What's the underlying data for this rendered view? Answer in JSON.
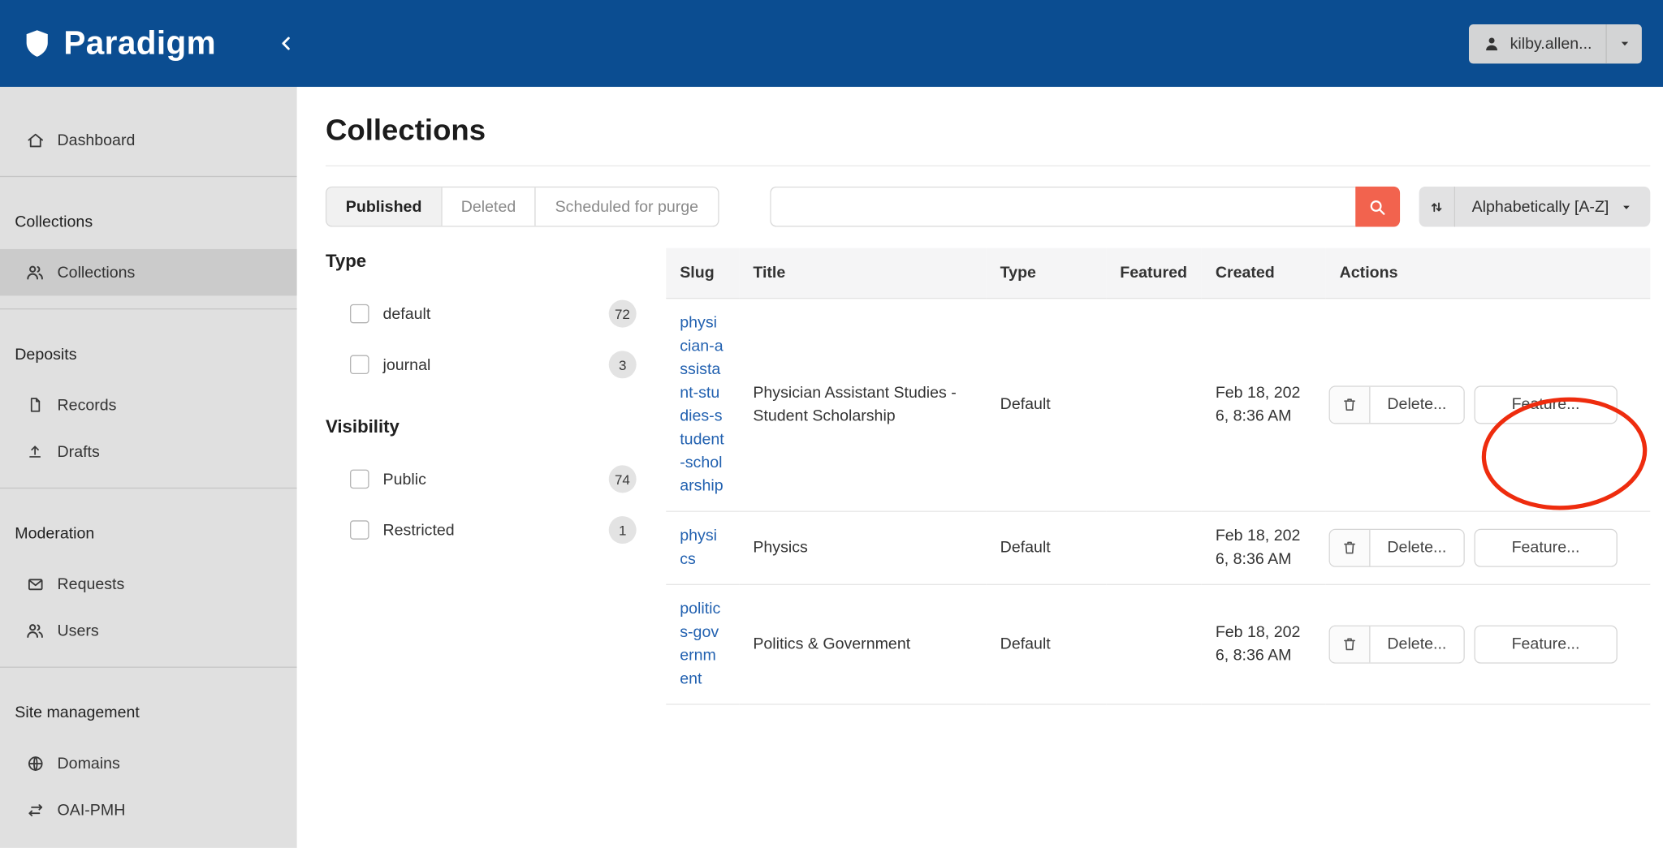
{
  "theme": {
    "navbar_color": "#0b4d91",
    "sidebar_color": "#e0e0e0",
    "search_button_color": "#f2634e",
    "link_color": "#2261b0"
  },
  "navbar": {
    "brand": "Paradigm",
    "user_label": "kilby.allen..."
  },
  "sidebar": {
    "sections": [
      {
        "header": "",
        "items": [
          {
            "label": "Dashboard"
          }
        ]
      },
      {
        "header": "Collections",
        "items": [
          {
            "label": "Collections"
          }
        ]
      },
      {
        "header": "Deposits",
        "items": [
          {
            "label": "Records"
          },
          {
            "label": "Drafts"
          }
        ]
      },
      {
        "header": "Moderation",
        "items": [
          {
            "label": "Requests"
          },
          {
            "label": "Users"
          }
        ]
      },
      {
        "header": "Site management",
        "items": [
          {
            "label": "Domains"
          },
          {
            "label": "OAI-PMH"
          }
        ]
      }
    ]
  },
  "main": {
    "title": "Collections",
    "tabs": [
      {
        "label": "Published"
      },
      {
        "label": "Deleted"
      },
      {
        "label": "Scheduled for purge"
      }
    ],
    "search": {
      "value": ""
    },
    "sort_label": "Alphabetically [A-Z]",
    "filters": [
      {
        "title": "Type",
        "options": [
          {
            "label": "default",
            "count": "72"
          },
          {
            "label": "journal",
            "count": "3"
          }
        ]
      },
      {
        "title": "Visibility",
        "options": [
          {
            "label": "Public",
            "count": "74"
          },
          {
            "label": "Restricted",
            "count": "1"
          }
        ]
      }
    ],
    "table": {
      "headers": [
        "Slug",
        "Title",
        "Type",
        "Featured",
        "Created",
        "Actions"
      ],
      "actions": {
        "delete": "Delete...",
        "feature": "Feature..."
      },
      "rows": [
        {
          "slug": "physician-assistant-studies-student-scholarship",
          "title": "Physician Assistant Studies - Student Scholarship",
          "type": "Default",
          "featured": "",
          "created": "Feb 18, 2026, 8:36 AM"
        },
        {
          "slug": "physics",
          "title": "Physics",
          "type": "Default",
          "featured": "",
          "created": "Feb 18, 2026, 8:36 AM"
        },
        {
          "slug": "politics-government",
          "title": "Politics & Government",
          "type": "Default",
          "featured": "",
          "created": "Feb 18, 2026, 8:36 AM"
        }
      ]
    }
  },
  "annotation": {
    "shape": "ellipse",
    "color": "#ee2c0e"
  }
}
